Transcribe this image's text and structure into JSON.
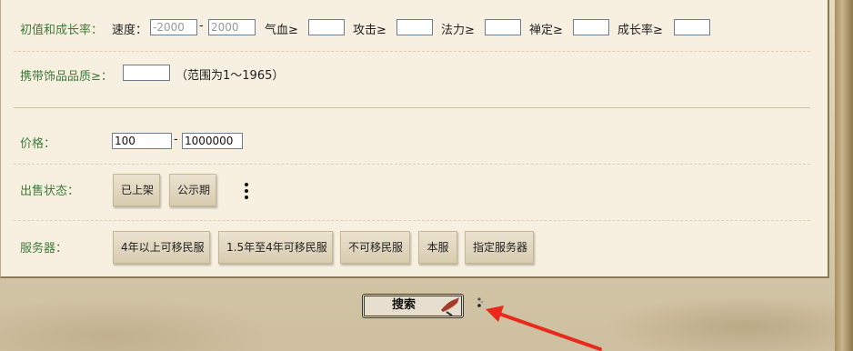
{
  "filters": {
    "growth": {
      "label": "初值和成长率：",
      "speed_label": "速度：",
      "speed_min": "-2000",
      "speed_dash": "-",
      "speed_max": "2000",
      "qixue_label": "气血≥",
      "gongji_label": "攻击≥",
      "fali_label": "法力≥",
      "chanding_label": "禅定≥",
      "chengzhang_label": "成长率≥"
    },
    "accessory": {
      "label": "携带饰品品质≥：",
      "range_hint": "（范围为1～1965）"
    },
    "price": {
      "label": "价格：",
      "min": "100",
      "dash": "-",
      "max": "1000000"
    },
    "sale_status": {
      "label": "出售状态：",
      "options": [
        "已上架",
        "公示期"
      ]
    },
    "server": {
      "label": "服务器：",
      "options": [
        "4年以上可移民服",
        "1.5年至4年可移民服",
        "不可移民服",
        "本服",
        "指定服务器"
      ]
    }
  },
  "search": {
    "label": "搜索"
  },
  "colors": {
    "label_green": "#3f7a3a",
    "annotation_arrow": "#e8291c"
  }
}
